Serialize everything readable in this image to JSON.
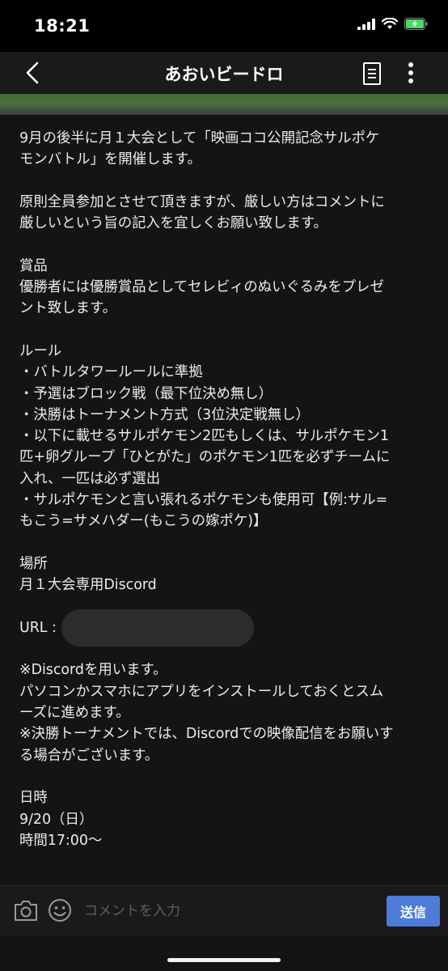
{
  "status_bar": {
    "time": "18:21",
    "icons": [
      "cellular-signal-icon",
      "wifi-icon",
      "battery-charging-icon"
    ],
    "battery_color": "#4cd964"
  },
  "nav": {
    "title": "あおいビードロ",
    "icons": [
      "back-chevron-icon",
      "document-icon",
      "more-vertical-icon"
    ]
  },
  "post": {
    "lines": [
      "9月の後半に月１大会として「映画ココ公開記念サルポケ",
      "モンバトル」を開催します。",
      "",
      "原則全員参加とさせて頂きますが、厳しい方はコメントに",
      "厳しいという旨の記入を宜しくお願い致します。",
      "",
      "賞品",
      "優勝者には優勝賞品としてセレビィのぬいぐるみをプレゼ",
      "ント致します。",
      "",
      "ルール",
      "・バトルタワールールに準拠",
      "・予選はブロック戦（最下位決め無し）",
      "・決勝はトーナメント方式（3位決定戦無し）",
      "・以下に載せるサルポケモン2匹もしくは、サルポケモン1",
      "匹+卵グループ「ひとがた」のポケモン1匹を必ずチームに",
      "入れ、一匹は必ず選出",
      "・サルポケモンと言い張れるポケモンも使用可【例:サル=",
      "もこう=サメハダー(もこうの嫁ポケ)】",
      "",
      "場所",
      "月１大会専用Discord",
      ""
    ],
    "url_label": "URL :",
    "lines_after_url": [
      "",
      "※Discordを用います。",
      "パソコンかスマホにアプリをインストールしておくとスム",
      "ーズに進めます。",
      "※決勝トーナメントでは、Discordでの映像配信をお願いす",
      "る場合がございます。",
      "",
      "日時",
      "9/20（日）",
      "時間17:00〜"
    ]
  },
  "comment_bar": {
    "placeholder": "コメントを入力",
    "send_label": "送信",
    "send_color": "#4f7bd8",
    "icons": [
      "camera-icon",
      "smiley-icon"
    ]
  }
}
